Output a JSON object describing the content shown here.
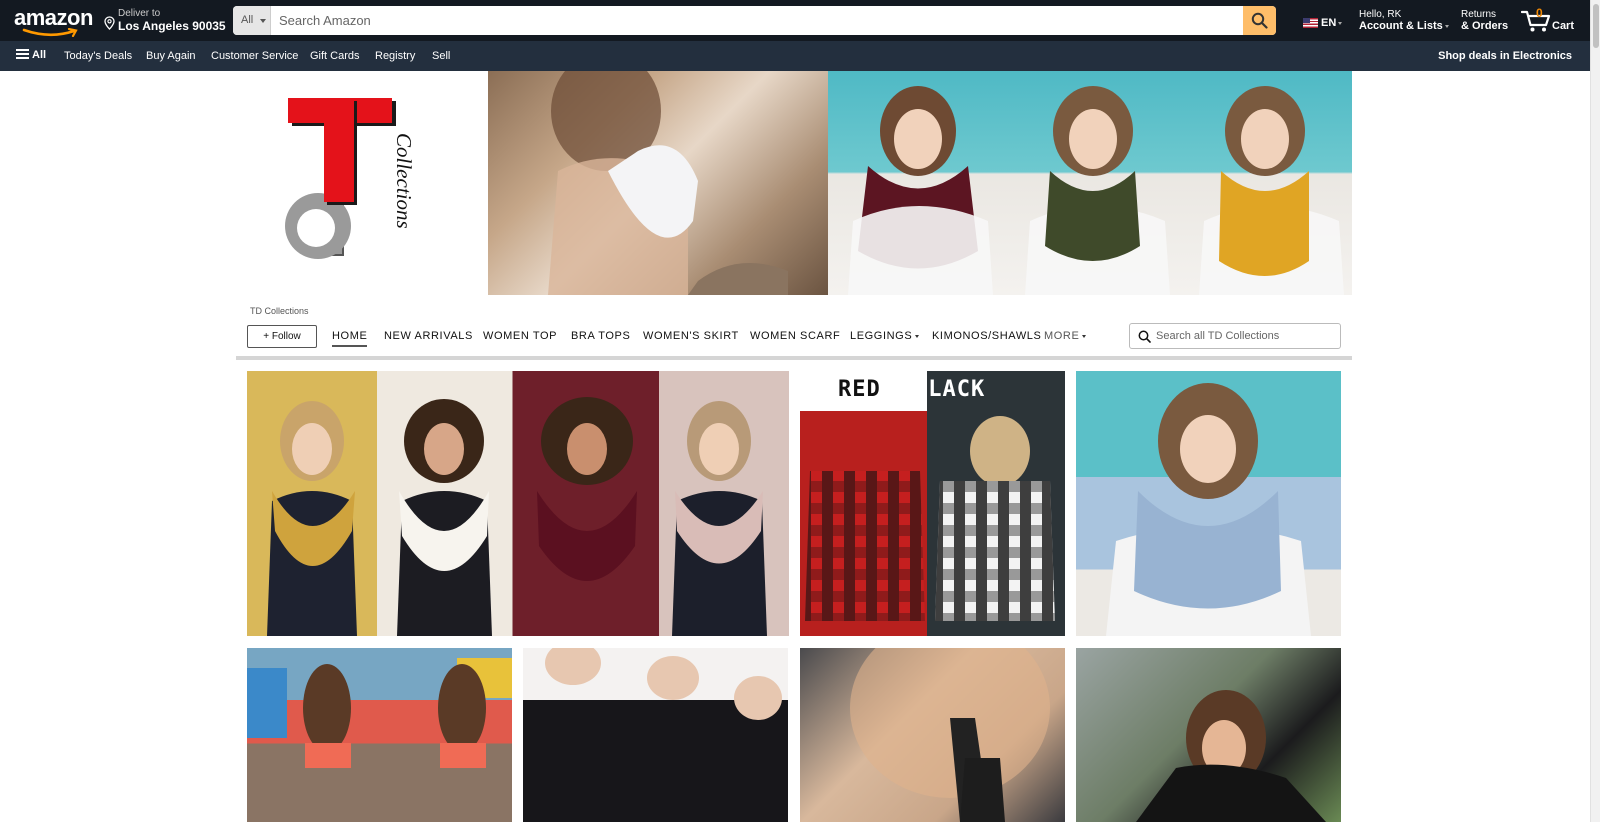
{
  "header": {
    "logo": "amazon",
    "deliver": {
      "line1": "Deliver to",
      "line2": "Los Angeles 90035"
    },
    "search": {
      "category": "All",
      "placeholder": "Search Amazon"
    },
    "language": "EN",
    "account": {
      "line1": "Hello, RK",
      "line2": "Account & Lists"
    },
    "returns": {
      "line1": "Returns",
      "line2": "& Orders"
    },
    "cart": {
      "count": "0",
      "label": "Cart"
    }
  },
  "subnav": {
    "all": "All",
    "items": [
      "Today's Deals",
      "Buy Again",
      "Customer Service",
      "Gift Cards",
      "Registry",
      "Sell"
    ],
    "promo": "Shop deals in Electronics"
  },
  "store": {
    "logo_text": "Collections",
    "name": "TD Collections",
    "follow": "+ Follow",
    "tabs": [
      "HOME",
      "NEW ARRIVALS",
      "WOMEN TOP",
      "BRA TOPS",
      "WOMEN'S SKIRT",
      "WOMEN SCARF",
      "LEGGINGS",
      "KIMONOS/SHAWLS",
      "MORE"
    ],
    "search_placeholder": "Search all TD Collections"
  },
  "tiles": {
    "rb_red": "RED",
    "rb_black": "BLACK"
  },
  "colors": {
    "nav_dark": "#131921",
    "nav_sub": "#232f3e",
    "search_button": "#febd69",
    "cart_count": "#f08804",
    "logo_red": "#e4121a",
    "logo_gray": "#9a9a9a"
  }
}
